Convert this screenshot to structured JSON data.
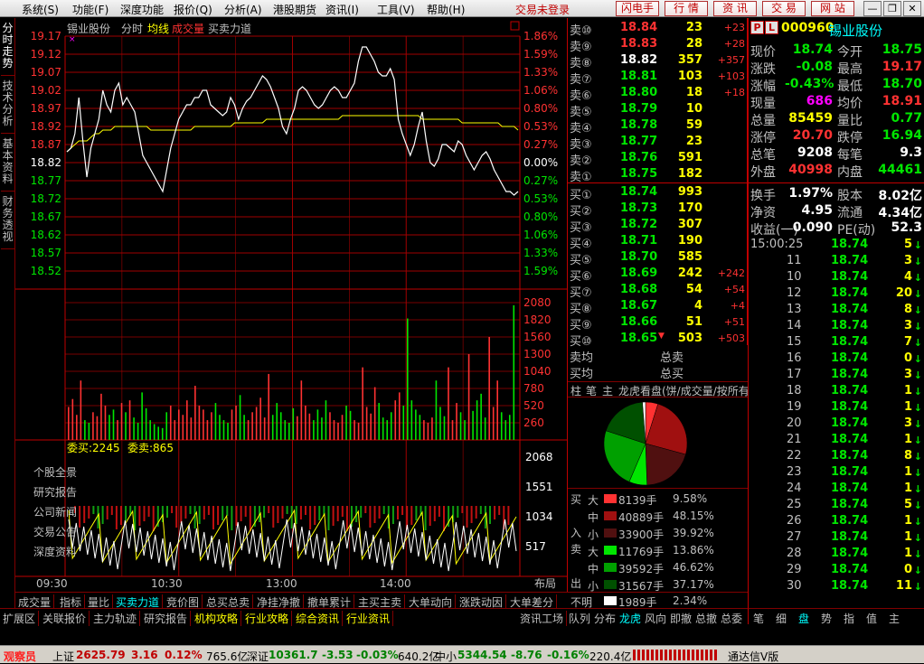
{
  "menubar": {
    "items": [
      "系统(S)",
      "功能(F)",
      "深度功能",
      "报价(Q)",
      "分析(A)",
      "港股期货",
      "资讯(I)",
      "工具(V)",
      "帮助(H)"
    ],
    "login_text": "交易未登录",
    "buttons": [
      "闪电手",
      "行 情",
      "资 讯",
      "交 易",
      "网 站"
    ],
    "window_buttons": [
      "—",
      "❐",
      "✕"
    ]
  },
  "left_tabs": [
    "分时走势",
    "技术分析",
    "基本资料",
    "财务透视"
  ],
  "chart": {
    "stock_name": "锡业股份",
    "legend": [
      "分时",
      "均线",
      "成交量",
      "买卖力道"
    ],
    "price_ticks": [
      "19.17",
      "19.12",
      "19.07",
      "19.02",
      "18.97",
      "18.92",
      "18.87",
      "18.82",
      "18.77",
      "18.72",
      "18.67",
      "18.62",
      "18.57",
      "18.52"
    ],
    "pct_ticks": [
      "1.86%",
      "1.59%",
      "1.33%",
      "1.06%",
      "0.80%",
      "0.53%",
      "0.27%",
      "0.00%",
      "0.27%",
      "0.53%",
      "0.80%",
      "1.06%",
      "1.33%",
      "1.59%"
    ],
    "vol_ticks": [
      "2080",
      "1820",
      "1560",
      "1300",
      "1040",
      "780",
      "520",
      "260"
    ],
    "power_label_buy": "委买:2245",
    "power_label_sell": "委卖:865",
    "power_ticks": [
      "2068",
      "1551",
      "1034",
      "517"
    ],
    "time_labels": [
      "09:30",
      "10:30",
      "13:00",
      "14:00"
    ],
    "layout_btn": "布局",
    "side_links": [
      "个股全景",
      "研究报告",
      "公司新闻",
      "交易公告",
      "深度资料"
    ],
    "colors": {
      "price_line": "#ffffff",
      "avg_line": "#ffff00",
      "up": "#ff3232",
      "down": "#00e600",
      "grid": "#a00000"
    }
  },
  "chart_data": {
    "type": "line",
    "title": "锡业股份",
    "prev_close": 18.82,
    "price_series": [
      18.85,
      18.86,
      18.9,
      19.0,
      18.88,
      18.78,
      18.86,
      18.9,
      18.94,
      19.02,
      18.98,
      18.96,
      19.02,
      19.04,
      18.98,
      19.0,
      18.98,
      18.96,
      18.9,
      18.84,
      18.82,
      18.8,
      18.78,
      18.76,
      18.74,
      18.8,
      18.86,
      18.9,
      18.94,
      18.96,
      18.98,
      18.98,
      19.0,
      19.0,
      19.02,
      19.02,
      18.98,
      18.97,
      18.96,
      18.95,
      18.96,
      19.0,
      18.98,
      18.94,
      18.97,
      18.99,
      19.0,
      19.02,
      19.04,
      19.06,
      19.05,
      19.03,
      19.0,
      18.97,
      18.92,
      18.9,
      18.94,
      18.97,
      19.02,
      19.03,
      19.02,
      19.0,
      18.98,
      18.97,
      18.98,
      19.0,
      19.02,
      19.03,
      19.02,
      19.0,
      19.0,
      19.02,
      19.04,
      19.1,
      19.14,
      19.14,
      19.12,
      19.1,
      19.07,
      19.06,
      19.06,
      19.08,
      19.05,
      18.94,
      18.9,
      18.87,
      18.84,
      18.87,
      18.92,
      18.96,
      18.88,
      18.82,
      18.81,
      18.83,
      18.87,
      18.87,
      18.86,
      18.85,
      18.88,
      18.87,
      18.84,
      18.82,
      18.8,
      18.82,
      18.84,
      18.85,
      18.83,
      18.8,
      18.78,
      18.76,
      18.74,
      18.74,
      18.73,
      18.74
    ],
    "avg_series": [
      18.85,
      18.86,
      18.87,
      18.88,
      18.88,
      18.88,
      18.89,
      18.9,
      18.9,
      18.91,
      18.91,
      18.91,
      18.92,
      18.92,
      18.92,
      18.92,
      18.92,
      18.92,
      18.92,
      18.92,
      18.92,
      18.91,
      18.91,
      18.91,
      18.91,
      18.91,
      18.91,
      18.91,
      18.91,
      18.91,
      18.91,
      18.91,
      18.92,
      18.92,
      18.92,
      18.92,
      18.92,
      18.92,
      18.92,
      18.92,
      18.92,
      18.92,
      18.93,
      18.93,
      18.93,
      18.93,
      18.93,
      18.93,
      18.93,
      18.93,
      18.94,
      18.94,
      18.94,
      18.94,
      18.94,
      18.94,
      18.94,
      18.94,
      18.94,
      18.94,
      18.94,
      18.94,
      18.94,
      18.94,
      18.94,
      18.94,
      18.94,
      18.94,
      18.94,
      18.95,
      18.95,
      18.95,
      18.95,
      18.95,
      18.95,
      18.95,
      18.95,
      18.95,
      18.95,
      18.95,
      18.95,
      18.95,
      18.95,
      18.95,
      18.95,
      18.95,
      18.95,
      18.95,
      18.95,
      18.94,
      18.94,
      18.94,
      18.94,
      18.94,
      18.94,
      18.94,
      18.94,
      18.94,
      18.94,
      18.93,
      18.93,
      18.93,
      18.93,
      18.93,
      18.93,
      18.93,
      18.93,
      18.93,
      18.93,
      18.92,
      18.92,
      18.92,
      18.92,
      18.91
    ],
    "ylim": [
      18.47,
      19.17
    ],
    "x_ticks": [
      "09:30",
      "10:30",
      "13:00",
      "14:00"
    ],
    "volume": [
      500,
      620,
      380,
      900,
      300,
      260,
      420,
      360,
      700,
      520,
      380,
      460,
      300,
      560,
      420,
      600,
      340,
      260,
      720,
      480,
      300,
      240,
      200,
      180,
      420,
      520,
      300,
      460,
      380,
      600,
      340,
      820,
      520,
      460,
      300,
      420,
      560,
      380,
      300,
      260,
      460,
      520,
      680,
      380,
      300,
      420,
      500,
      640,
      340,
      1000,
      380,
      560,
      420,
      300,
      260,
      480,
      360,
      900,
      520,
      400,
      300,
      460,
      340,
      600,
      420,
      300,
      260,
      380,
      520,
      440,
      300,
      260,
      1100,
      500,
      400,
      800,
      560,
      340,
      300,
      420,
      600,
      720,
      520,
      1840,
      600,
      460,
      380,
      300,
      260,
      340,
      900,
      500,
      360,
      1100,
      300,
      560,
      420,
      300,
      1300,
      440,
      600,
      700,
      340,
      1560,
      500,
      900,
      420,
      300,
      380,
      2040
    ],
    "vol_ylim": [
      0,
      2080
    ]
  },
  "orderbook": {
    "sell": [
      {
        "label": "卖⑩",
        "price": "18.84",
        "vol": "23",
        "chg": "+23"
      },
      {
        "label": "卖⑨",
        "price": "18.83",
        "vol": "28",
        "chg": "+28"
      },
      {
        "label": "卖⑧",
        "price": "18.82",
        "vol": "357",
        "chg": "+357"
      },
      {
        "label": "卖⑦",
        "price": "18.81",
        "vol": "103",
        "chg": "+103"
      },
      {
        "label": "卖⑥",
        "price": "18.80",
        "vol": "18",
        "chg": "+18"
      },
      {
        "label": "卖⑤",
        "price": "18.79",
        "vol": "10",
        "chg": ""
      },
      {
        "label": "卖④",
        "price": "18.78",
        "vol": "59",
        "chg": ""
      },
      {
        "label": "卖③",
        "price": "18.77",
        "vol": "23",
        "chg": ""
      },
      {
        "label": "卖②",
        "price": "18.76",
        "vol": "591",
        "chg": ""
      },
      {
        "label": "卖①",
        "price": "18.75",
        "vol": "182",
        "chg": ""
      }
    ],
    "buy": [
      {
        "label": "买①",
        "price": "18.74",
        "vol": "993",
        "chg": ""
      },
      {
        "label": "买②",
        "price": "18.73",
        "vol": "170",
        "chg": ""
      },
      {
        "label": "买③",
        "price": "18.72",
        "vol": "307",
        "chg": ""
      },
      {
        "label": "买④",
        "price": "18.71",
        "vol": "190",
        "chg": ""
      },
      {
        "label": "买⑤",
        "price": "18.70",
        "vol": "585",
        "chg": ""
      },
      {
        "label": "买⑥",
        "price": "18.69",
        "vol": "242",
        "chg": "+242"
      },
      {
        "label": "买⑦",
        "price": "18.68",
        "vol": "54",
        "chg": "+54"
      },
      {
        "label": "买⑧",
        "price": "18.67",
        "vol": "4",
        "chg": "+4"
      },
      {
        "label": "买⑨",
        "price": "18.66",
        "vol": "51",
        "chg": "+51"
      },
      {
        "label": "买⑩",
        "price": "18.65",
        "vol": "503",
        "chg": "+503"
      }
    ],
    "avg_sell_label": "卖均",
    "avg_buy_label": "买均",
    "total_sell_label": "总卖",
    "total_buy_label": "总买"
  },
  "dragon": {
    "tabs": [
      "柱",
      "笔",
      "主"
    ],
    "title": "龙虎看盘(饼/成交量/按所有"
  },
  "pie_data": {
    "slices": [
      {
        "value": 9.58,
        "color": "#ff3232"
      },
      {
        "value": 48.15,
        "color": "#a01010"
      },
      {
        "value": 39.92,
        "color": "#501010"
      },
      {
        "value": 13.86,
        "color": "#00e600"
      },
      {
        "value": 46.62,
        "color": "#00a000"
      },
      {
        "value": 37.17,
        "color": "#005000"
      },
      {
        "value": 2.34,
        "color": "#ffffff"
      }
    ]
  },
  "flow": {
    "buy_side": [
      "买",
      "入"
    ],
    "sell_side": [
      "卖",
      "出"
    ],
    "rows": [
      {
        "size": "大",
        "vol": "8139手",
        "pct": "9.58%",
        "color": "#ff3232"
      },
      {
        "size": "中",
        "vol": "40889手",
        "pct": "48.15%",
        "color": "#a01010"
      },
      {
        "size": "小",
        "vol": "33900手",
        "pct": "39.92%",
        "color": "#501010"
      },
      {
        "size": "大",
        "vol": "11769手",
        "pct": "13.86%",
        "color": "#00e600"
      },
      {
        "size": "中",
        "vol": "39592手",
        "pct": "46.62%",
        "color": "#00a000"
      },
      {
        "size": "小",
        "vol": "31567手",
        "pct": "37.17%",
        "color": "#005000"
      }
    ],
    "unknown_label": "不明",
    "unknown_vol": "1989手",
    "unknown_pct": "2.34%"
  },
  "right_tabs": [
    "队列",
    "分布",
    "龙虎",
    "风向",
    "即撤",
    "总撤",
    "总委"
  ],
  "quote": {
    "code": "000960",
    "name": "锡业股份",
    "box_p": "P",
    "box_l": "L",
    "rows": [
      [
        {
          "k": "现价",
          "v": "18.74",
          "c": "grn"
        },
        {
          "k": "今开",
          "v": "18.75",
          "c": "grn"
        }
      ],
      [
        {
          "k": "涨跌",
          "v": "-0.08",
          "c": "grn"
        },
        {
          "k": "最高",
          "v": "19.17",
          "c": "red"
        }
      ],
      [
        {
          "k": "涨幅",
          "v": "-0.43%",
          "c": "grn"
        },
        {
          "k": "最低",
          "v": "18.70",
          "c": "grn"
        }
      ],
      [
        {
          "k": "现量",
          "v": "686",
          "c": "mag"
        },
        {
          "k": "均价",
          "v": "18.91",
          "c": "red"
        }
      ],
      [
        {
          "k": "总量",
          "v": "85459",
          "c": "yel"
        },
        {
          "k": "量比",
          "v": "0.77",
          "c": "grn"
        }
      ],
      [
        {
          "k": "涨停",
          "v": "20.70",
          "c": "red"
        },
        {
          "k": "跌停",
          "v": "16.94",
          "c": "grn"
        }
      ],
      [
        {
          "k": "总笔",
          "v": "9208",
          "c": "wht"
        },
        {
          "k": "每笔",
          "v": "9.3",
          "c": "wht"
        }
      ],
      [
        {
          "k": "外盘",
          "v": "40998",
          "c": "red"
        },
        {
          "k": "内盘",
          "v": "44461",
          "c": "grn"
        }
      ],
      [
        {
          "k": "换手",
          "v": "1.97%",
          "c": "wht"
        },
        {
          "k": "股本",
          "v": "8.02亿",
          "c": "wht"
        }
      ],
      [
        {
          "k": "净资",
          "v": "4.95",
          "c": "wht"
        },
        {
          "k": "流通",
          "v": "4.34亿",
          "c": "wht"
        }
      ],
      [
        {
          "k": "收益(一)",
          "v": "0.090",
          "c": "wht"
        },
        {
          "k": "PE(动)",
          "v": "52.3",
          "c": "wht"
        }
      ]
    ]
  },
  "ticks": [
    {
      "t": "15:00:25",
      "p": "18.74",
      "v": "5"
    },
    {
      "t": "11",
      "p": "18.74",
      "v": "3"
    },
    {
      "t": "10",
      "p": "18.74",
      "v": "4"
    },
    {
      "t": "12",
      "p": "18.74",
      "v": "20"
    },
    {
      "t": "13",
      "p": "18.74",
      "v": "8"
    },
    {
      "t": "14",
      "p": "18.74",
      "v": "3"
    },
    {
      "t": "15",
      "p": "18.74",
      "v": "7"
    },
    {
      "t": "16",
      "p": "18.74",
      "v": "0"
    },
    {
      "t": "17",
      "p": "18.74",
      "v": "3"
    },
    {
      "t": "18",
      "p": "18.74",
      "v": "1"
    },
    {
      "t": "19",
      "p": "18.74",
      "v": "1"
    },
    {
      "t": "20",
      "p": "18.74",
      "v": "3"
    },
    {
      "t": "21",
      "p": "18.74",
      "v": "1"
    },
    {
      "t": "22",
      "p": "18.74",
      "v": "8"
    },
    {
      "t": "23",
      "p": "18.74",
      "v": "1"
    },
    {
      "t": "24",
      "p": "18.74",
      "v": "1"
    },
    {
      "t": "25",
      "p": "18.74",
      "v": "5"
    },
    {
      "t": "26",
      "p": "18.74",
      "v": "1"
    },
    {
      "t": "27",
      "p": "18.74",
      "v": "1"
    },
    {
      "t": "28",
      "p": "18.74",
      "v": "1"
    },
    {
      "t": "29",
      "p": "18.74",
      "v": "0"
    },
    {
      "t": "30",
      "p": "18.74",
      "v": "11"
    }
  ],
  "tick_tabs": [
    "笔",
    "细",
    "盘",
    "势",
    "指",
    "值",
    "主"
  ],
  "bottom_tabs1": [
    "成交量",
    "指标",
    "量比",
    "买卖力道",
    "竞价图",
    "总买总卖",
    "净挂净撤",
    "撤单累计",
    "主买主卖",
    "大单动向",
    "涨跌动因",
    "大单差分"
  ],
  "bottom_tabs2": [
    "扩展区",
    "关联报价",
    "主力轨迹",
    "研究报告",
    "机构攻略",
    "行业攻略",
    "综合资讯",
    "行业资讯",
    "资讯工场"
  ],
  "status": {
    "brand": "观察员",
    "sh_label": "上证",
    "sh_val": "2625.79",
    "sh_chg": "3.16",
    "sh_pct": "0.12%",
    "sh_amt": "765.6亿",
    "sz_label": "深证",
    "sz_val": "10361.7",
    "sz_chg": "-3.53",
    "sz_pct": "-0.03%",
    "sz_amt": "640.2亿",
    "zx_label": "中小",
    "zx_val": "5344.54",
    "zx_chg": "-8.76",
    "zx_pct": "-0.16%",
    "zx_amt": "220.4亿",
    "server": "通达信V版"
  }
}
